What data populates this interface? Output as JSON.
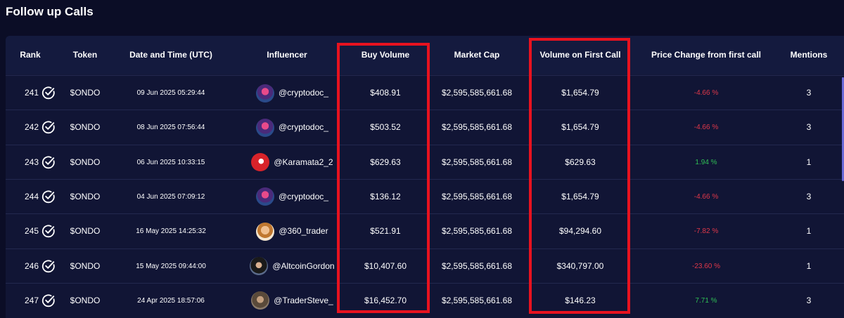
{
  "title": "Follow up Calls",
  "columns": {
    "rank": "Rank",
    "token": "Token",
    "datetime": "Date and Time (UTC)",
    "influencer": "Influencer",
    "buy_volume": "Buy Volume",
    "market_cap": "Market Cap",
    "volume_first_call": "Volume on First Call",
    "price_change": "Price Change from first call",
    "mentions": "Mentions"
  },
  "rows": [
    {
      "rank": "241",
      "token": "$ONDO",
      "datetime": "09 Jun 2025 05:29:44",
      "influencer": "@cryptodoc_",
      "avatar": "avatar-cryptodoc",
      "buy_volume": "$408.91",
      "market_cap": "$2,595,585,661.68",
      "volume_first_call": "$1,654.79",
      "price_change": "-4.66 %",
      "trend": "negative",
      "mentions": "3"
    },
    {
      "rank": "242",
      "token": "$ONDO",
      "datetime": "08 Jun 2025 07:56:44",
      "influencer": "@cryptodoc_",
      "avatar": "avatar-cryptodoc",
      "buy_volume": "$503.52",
      "market_cap": "$2,595,585,661.68",
      "volume_first_call": "$1,654.79",
      "price_change": "-4.66 %",
      "trend": "negative",
      "mentions": "3"
    },
    {
      "rank": "243",
      "token": "$ONDO",
      "datetime": "06 Jun 2025 10:33:15",
      "influencer": "@Karamata2_2",
      "avatar": "avatar-karamata",
      "buy_volume": "$629.63",
      "market_cap": "$2,595,585,661.68",
      "volume_first_call": "$629.63",
      "price_change": "1.94 %",
      "trend": "positive",
      "mentions": "1"
    },
    {
      "rank": "244",
      "token": "$ONDO",
      "datetime": "04 Jun 2025 07:09:12",
      "influencer": "@cryptodoc_",
      "avatar": "avatar-cryptodoc",
      "buy_volume": "$136.12",
      "market_cap": "$2,595,585,661.68",
      "volume_first_call": "$1,654.79",
      "price_change": "-4.66 %",
      "trend": "negative",
      "mentions": "3"
    },
    {
      "rank": "245",
      "token": "$ONDO",
      "datetime": "16 May 2025 14:25:32",
      "influencer": "@360_trader",
      "avatar": "avatar-360trader",
      "buy_volume": "$521.91",
      "market_cap": "$2,595,585,661.68",
      "volume_first_call": "$94,294.60",
      "price_change": "-7.82 %",
      "trend": "negative",
      "mentions": "1"
    },
    {
      "rank": "246",
      "token": "$ONDO",
      "datetime": "15 May 2025 09:44:00",
      "influencer": "@AltcoinGordon",
      "avatar": "avatar-altcoingordon",
      "buy_volume": "$10,407.60",
      "market_cap": "$2,595,585,661.68",
      "volume_first_call": "$340,797.00",
      "price_change": "-23.60 %",
      "trend": "negative",
      "mentions": "1"
    },
    {
      "rank": "247",
      "token": "$ONDO",
      "datetime": "24 Apr 2025 18:57:06",
      "influencer": "@TraderSteve_",
      "avatar": "avatar-tradersteve",
      "buy_volume": "$16,452.70",
      "market_cap": "$2,595,585,661.68",
      "volume_first_call": "$146.23",
      "price_change": "7.71 %",
      "trend": "positive",
      "mentions": "3"
    }
  ],
  "colors": {
    "background": "#0b0d26",
    "negative": "#e0384a",
    "positive": "#2fbf55",
    "highlight_box": "#e8121f"
  }
}
